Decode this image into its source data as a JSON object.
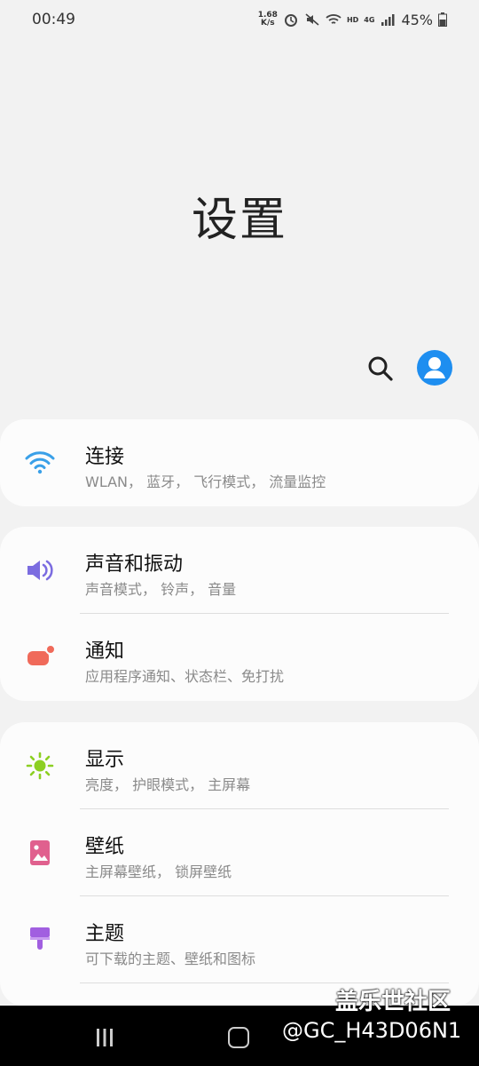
{
  "status": {
    "time": "00:49",
    "net_speed_value": "1.68",
    "net_speed_unit": "K/s",
    "hd_label": "HD",
    "network_label": "4G",
    "battery": "45%"
  },
  "page_title": "设置",
  "groups": [
    {
      "items": [
        {
          "name": "连接",
          "desc": "WLAN， 蓝牙， 飞行模式， 流量监控",
          "icon": "wifi-icon",
          "color": "#3aa0e8"
        }
      ]
    },
    {
      "items": [
        {
          "name": "声音和振动",
          "desc": "声音模式， 铃声， 音量",
          "icon": "speaker-icon",
          "color": "#7b6ce0"
        },
        {
          "name": "通知",
          "desc": "应用程序通知、状态栏、免打扰",
          "icon": "notification-icon",
          "color": "#f06a5a"
        }
      ]
    },
    {
      "items": [
        {
          "name": "显示",
          "desc": "亮度， 护眼模式， 主屏幕",
          "icon": "brightness-icon",
          "color": "#8ccf22"
        },
        {
          "name": "壁纸",
          "desc": "主屏幕壁纸， 锁屏壁纸",
          "icon": "wallpaper-icon",
          "color": "#e0608e"
        },
        {
          "name": "主题",
          "desc": "可下载的主题、壁纸和图标",
          "icon": "theme-brush-icon",
          "color": "#a15fe0"
        }
      ]
    }
  ],
  "watermark": {
    "site": "盖乐世社区",
    "user": "@GC_H43D06N1"
  }
}
